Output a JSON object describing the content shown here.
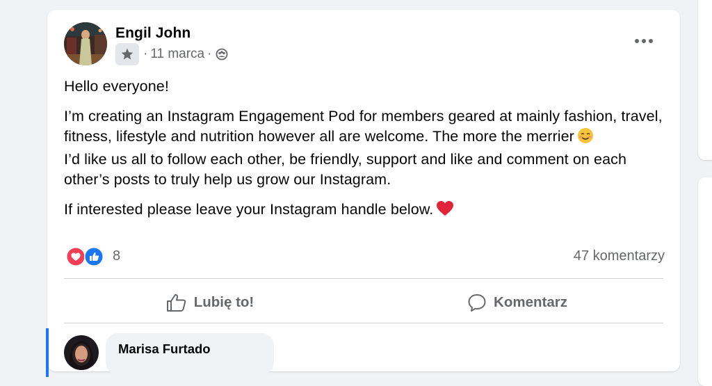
{
  "post": {
    "author_name": "Engil John",
    "date": "11 marca",
    "separator": "·",
    "icons": {
      "badge": "star-badge-icon",
      "audience": "group-audience-icon",
      "menu": "more-options-icon"
    },
    "paragraphs": {
      "greeting": "Hello everyone!",
      "line1": "I’m creating an Instagram Engagement Pod for members geared at mainly fashion, travel, fitness, lifestyle and nutrition however all are welcome. The more the merrier",
      "emoji1": "smiling-face-emoji",
      "line2": "I’d like us all to follow each other, be friendly, support and like and comment on each other’s posts to truly help us grow our Instagram.",
      "line3": "If interested please leave your Instagram handle below.",
      "emoji2": "red-heart-emoji"
    },
    "reactions": {
      "types": [
        "love",
        "like"
      ],
      "count": "8",
      "comments_label": "47 komentarzy"
    },
    "actions": {
      "like_label": "Lubię to!",
      "comment_label": "Komentarz"
    },
    "colors": {
      "accent": "#1877f2",
      "love": "#f33e58",
      "secondary_text": "#65676b"
    }
  },
  "comment": {
    "author_name": "Marisa Furtado"
  }
}
